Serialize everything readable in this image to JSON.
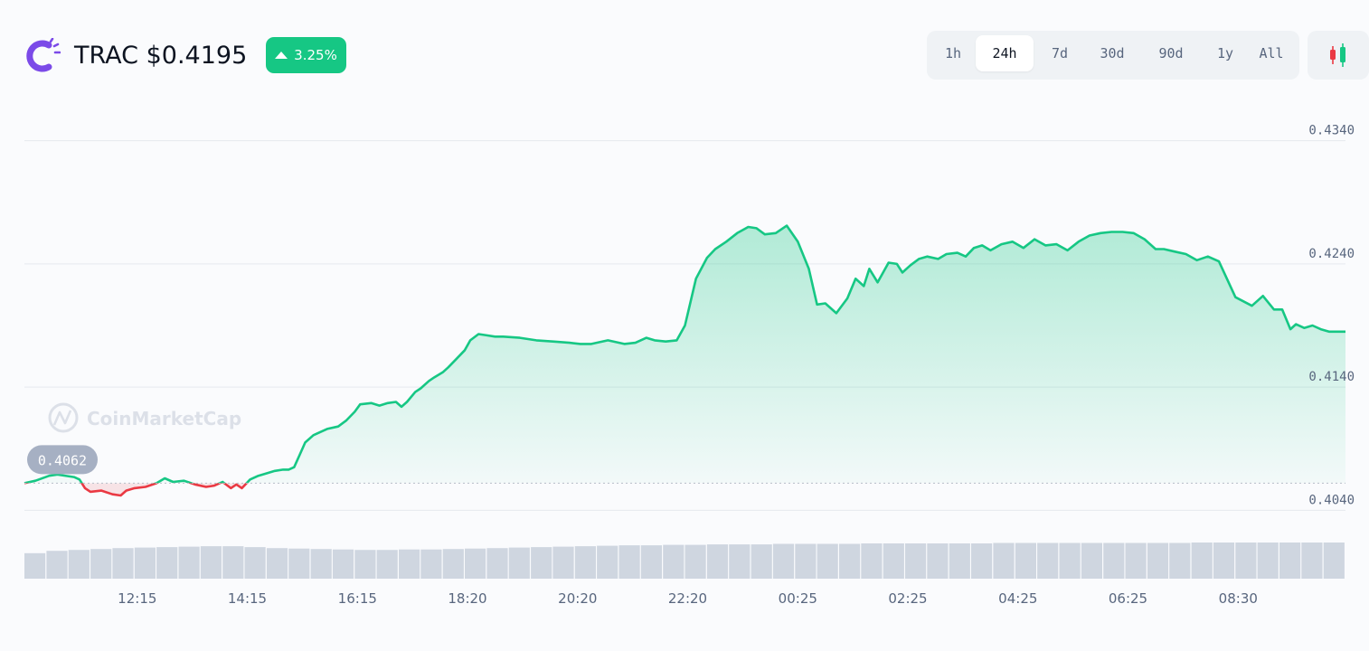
{
  "header": {
    "symbol": "TRAC",
    "price": "$0.4195",
    "change": "3.25%",
    "change_direction": "up",
    "logo_icon": "trac-logo-icon",
    "candle_icon": "candlestick-chart-icon"
  },
  "time_ranges": [
    "1h",
    "24h",
    "7d",
    "30d",
    "90d",
    "1y",
    "All"
  ],
  "active_range": "24h",
  "colors": {
    "up": "#16c784",
    "down": "#ea3943",
    "logo": "#7b4ae8",
    "text": "#0d1421",
    "muted": "#58667e"
  },
  "watermark": "CoinMarketCap",
  "chart_data": {
    "type": "area",
    "baseline_value": 0.4062,
    "baseline_label": "0.4062",
    "ylim": [
      0.403,
      0.435
    ],
    "y_ticks": [
      0.404,
      0.414,
      0.424,
      0.434
    ],
    "y_tick_labels": [
      "0.4040",
      "0.4140",
      "0.4240",
      "0.4340"
    ],
    "x_tick_labels": [
      "12:15",
      "14:15",
      "16:15",
      "18:20",
      "20:20",
      "22:20",
      "00:25",
      "02:25",
      "04:25",
      "06:25",
      "08:30"
    ],
    "x_tick_positions": [
      2.05,
      4.05,
      6.05,
      8.05,
      10.05,
      12.05,
      14.05,
      16.05,
      18.05,
      20.05,
      22.05
    ],
    "xlim": [
      0,
      24
    ],
    "series": [
      {
        "x": [
          0,
          0.2,
          0.45,
          0.6,
          0.9,
          1.0,
          1.1,
          1.2,
          1.4,
          1.6,
          1.75,
          1.85,
          2.0,
          2.2,
          2.4,
          2.55,
          2.7,
          2.9,
          3.1,
          3.3,
          3.45,
          3.6,
          3.75,
          3.85,
          3.95,
          4.1,
          4.25,
          4.4,
          4.55,
          4.7,
          4.8,
          4.9,
          5.0,
          5.1,
          5.25,
          5.4,
          5.5,
          5.7,
          5.85,
          6.0,
          6.1,
          6.3,
          6.45,
          6.6,
          6.75,
          6.85,
          6.95,
          7.1,
          7.2,
          7.35,
          7.45,
          7.6,
          7.7,
          7.85,
          8.0,
          8.1,
          8.25,
          8.4,
          8.55,
          8.7,
          9.0,
          9.3,
          9.6,
          9.9,
          10.1,
          10.3,
          10.6,
          10.9,
          11.1,
          11.3,
          11.45,
          11.65,
          11.85,
          12.0,
          12.2,
          12.4,
          12.55,
          12.75,
          12.95,
          13.15,
          13.3,
          13.45,
          13.65,
          13.85,
          14.05,
          14.25,
          14.4,
          14.55,
          14.75,
          14.95,
          15.1,
          15.25,
          15.35,
          15.5,
          15.7,
          15.85,
          15.95,
          16.1,
          16.25,
          16.4,
          16.6,
          16.75,
          16.95,
          17.1,
          17.25,
          17.4,
          17.55,
          17.75,
          17.95,
          18.15,
          18.35,
          18.55,
          18.75,
          18.95,
          19.15,
          19.35,
          19.55,
          19.75,
          19.95,
          20.15,
          20.35,
          20.55,
          20.7,
          20.9,
          21.1,
          21.3,
          21.5,
          21.7,
          22.0,
          22.3,
          22.5,
          22.7,
          22.85,
          23.0,
          23.1,
          23.25,
          23.4,
          23.55,
          23.7,
          24.0
        ],
        "y": [
          0.4062,
          0.4064,
          0.4068,
          0.4069,
          0.4067,
          0.4065,
          0.4058,
          0.4055,
          0.4056,
          0.4053,
          0.4052,
          0.4056,
          0.4058,
          0.4059,
          0.4062,
          0.4066,
          0.4063,
          0.4064,
          0.4061,
          0.4059,
          0.406,
          0.4063,
          0.4058,
          0.4061,
          0.4058,
          0.4065,
          0.4068,
          0.407,
          0.4072,
          0.4073,
          0.4073,
          0.4075,
          0.4085,
          0.4095,
          0.4101,
          0.4104,
          0.4106,
          0.4108,
          0.4113,
          0.412,
          0.4126,
          0.4127,
          0.4125,
          0.4127,
          0.4128,
          0.4124,
          0.4128,
          0.4136,
          0.4139,
          0.4145,
          0.4148,
          0.4152,
          0.4156,
          0.4163,
          0.417,
          0.4178,
          0.4183,
          0.4182,
          0.4181,
          0.4181,
          0.418,
          0.4178,
          0.4177,
          0.4176,
          0.4175,
          0.4175,
          0.4178,
          0.4175,
          0.4176,
          0.418,
          0.4178,
          0.4177,
          0.4178,
          0.419,
          0.4228,
          0.4245,
          0.4252,
          0.4258,
          0.4265,
          0.427,
          0.4269,
          0.4264,
          0.4265,
          0.4271,
          0.4258,
          0.4236,
          0.4207,
          0.4208,
          0.42,
          0.4212,
          0.4228,
          0.4222,
          0.4236,
          0.4225,
          0.4241,
          0.424,
          0.4233,
          0.4239,
          0.4244,
          0.4246,
          0.4244,
          0.4248,
          0.4249,
          0.4246,
          0.4253,
          0.4255,
          0.4251,
          0.4256,
          0.4258,
          0.4253,
          0.426,
          0.4255,
          0.4256,
          0.4251,
          0.4258,
          0.4263,
          0.4265,
          0.4266,
          0.4266,
          0.4265,
          0.426,
          0.4252,
          0.4252,
          0.425,
          0.4248,
          0.4243,
          0.4246,
          0.4242,
          0.4213,
          0.4206,
          0.4214,
          0.4203,
          0.4203,
          0.4187,
          0.4191,
          0.4188,
          0.419,
          0.4187,
          0.4185,
          0.4185
        ]
      }
    ],
    "volume": {
      "values": [
        0.55,
        0.6,
        0.62,
        0.64,
        0.66,
        0.67,
        0.68,
        0.69,
        0.7,
        0.7,
        0.68,
        0.66,
        0.65,
        0.64,
        0.63,
        0.62,
        0.62,
        0.63,
        0.63,
        0.64,
        0.65,
        0.66,
        0.67,
        0.68,
        0.69,
        0.7,
        0.71,
        0.72,
        0.72,
        0.73,
        0.73,
        0.74,
        0.74,
        0.74,
        0.75,
        0.75,
        0.75,
        0.75,
        0.76,
        0.76,
        0.76,
        0.76,
        0.76,
        0.76,
        0.77,
        0.77,
        0.77,
        0.77,
        0.77,
        0.77,
        0.77,
        0.77,
        0.77,
        0.78,
        0.78,
        0.78,
        0.78,
        0.78,
        0.78,
        0.78
      ]
    },
    "grid": true
  }
}
